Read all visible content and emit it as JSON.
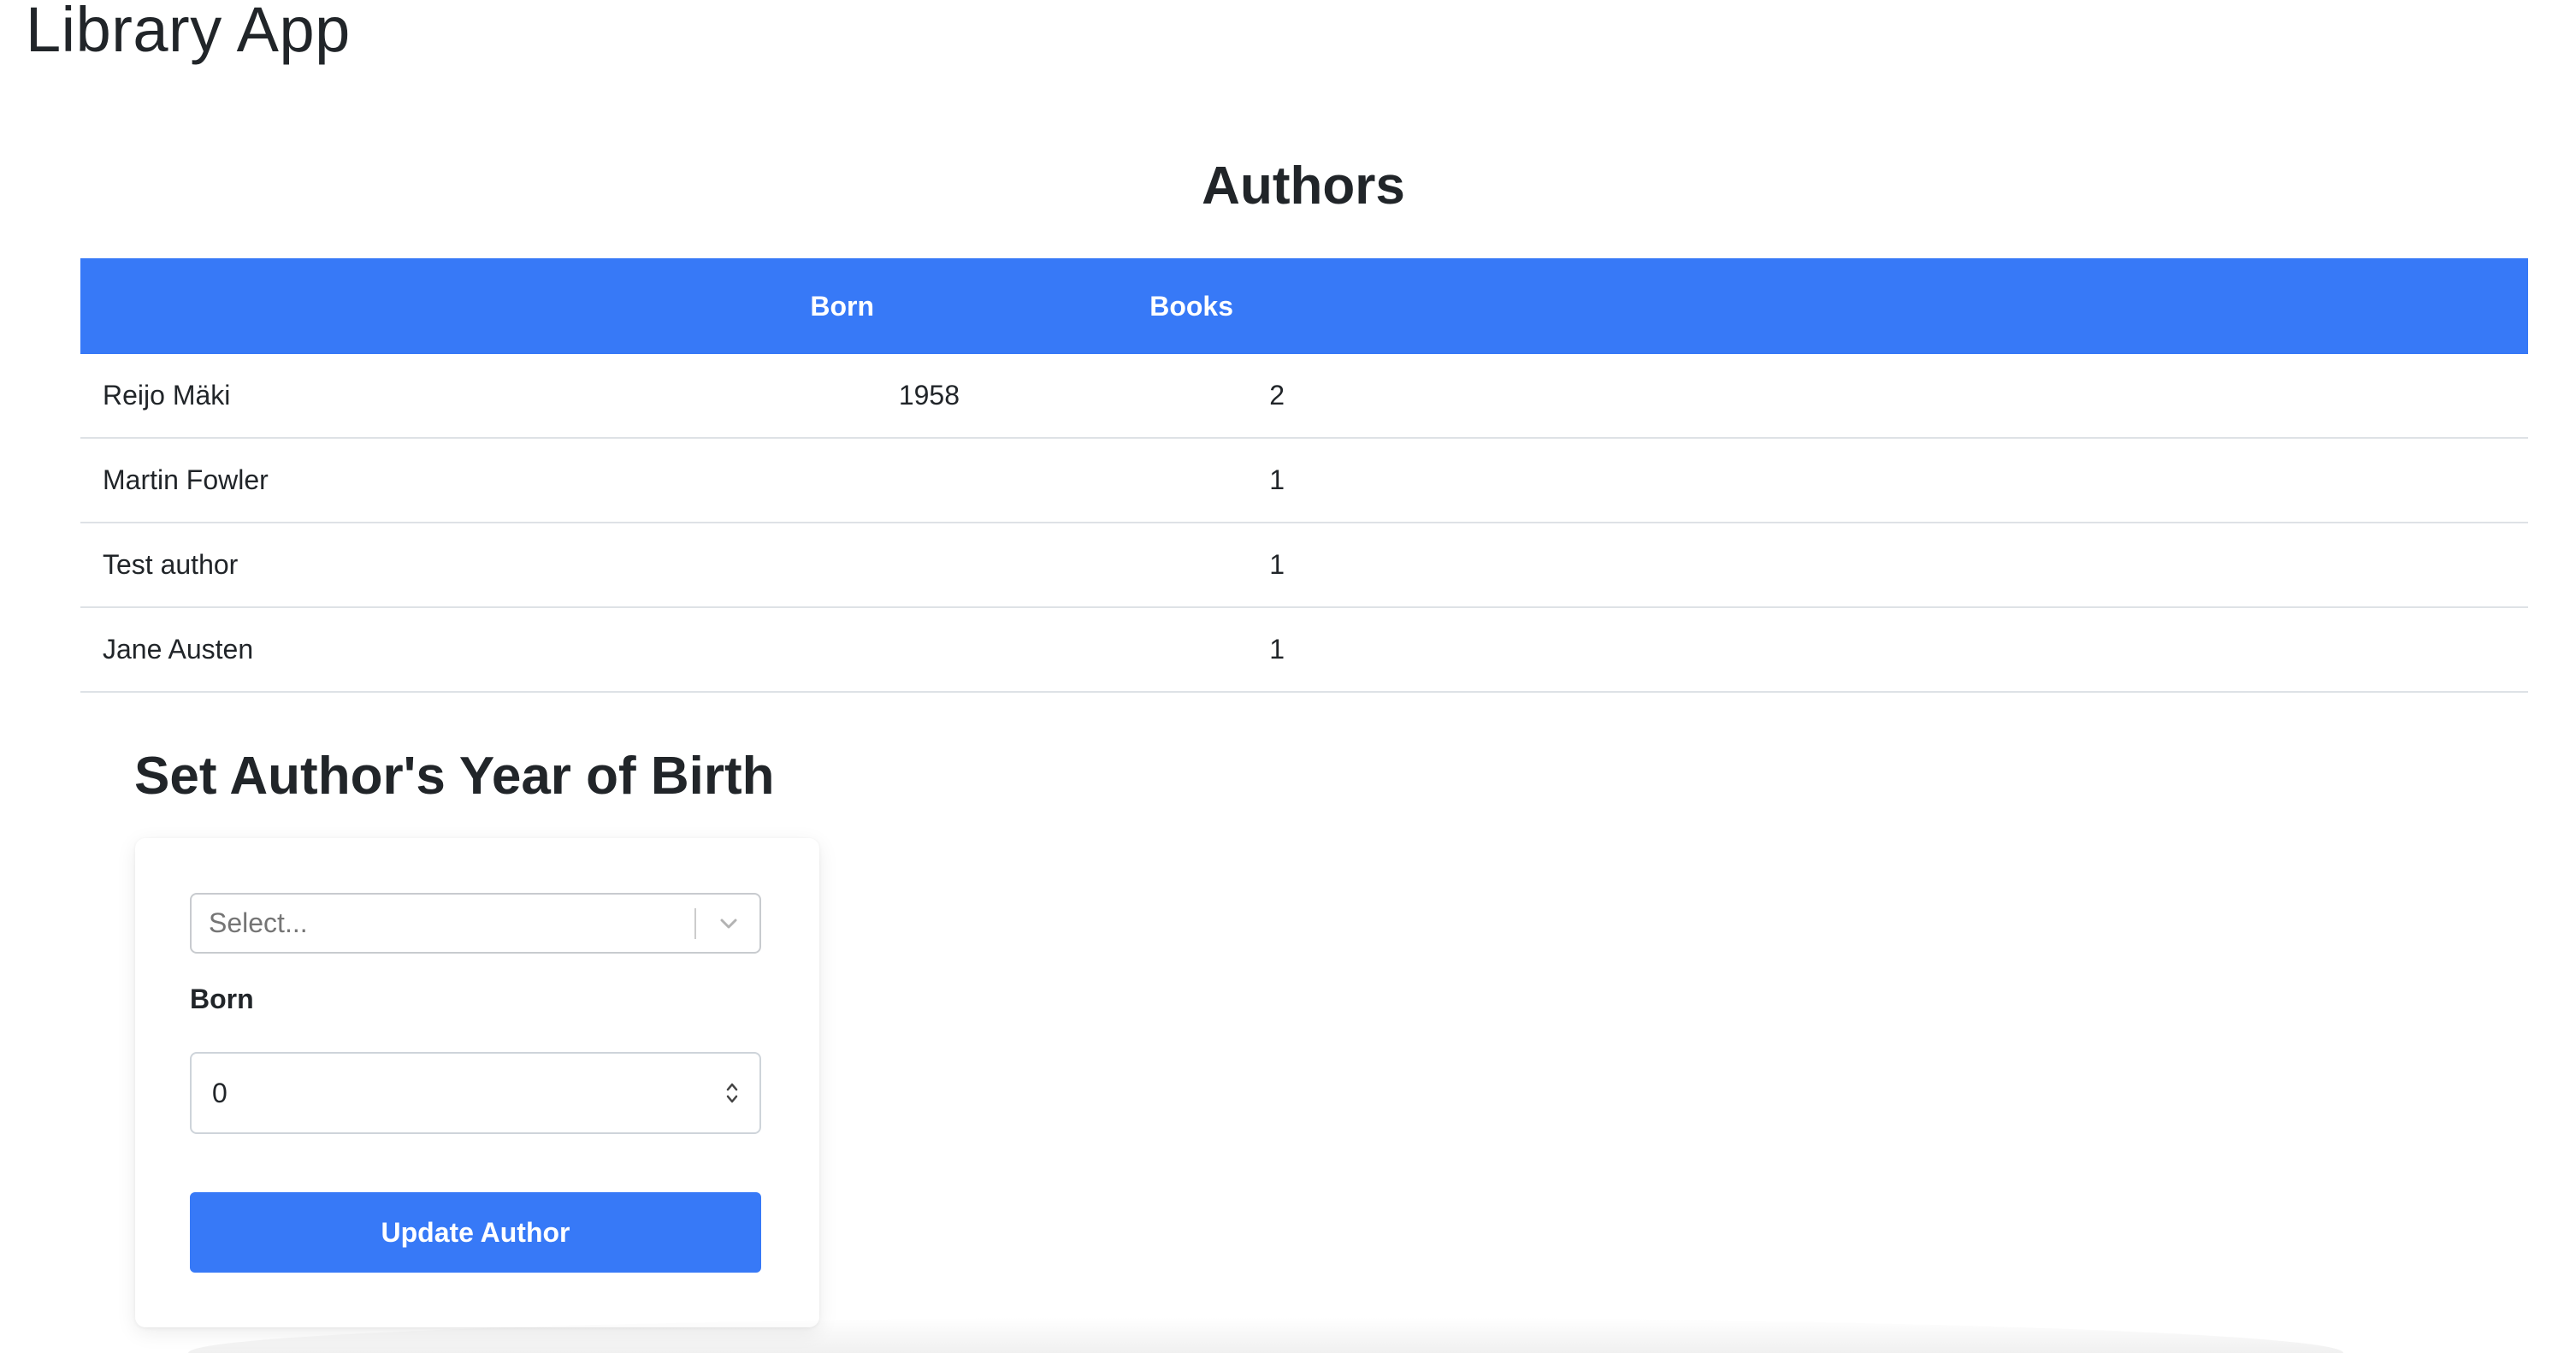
{
  "app": {
    "title": "Library App"
  },
  "authors_section": {
    "title": "Authors",
    "columns": [
      "",
      "Born",
      "Books"
    ],
    "rows": [
      {
        "name": "Reijo Mäki",
        "born": "1958",
        "books": "2"
      },
      {
        "name": "Martin Fowler",
        "born": "",
        "books": "1"
      },
      {
        "name": "Test author",
        "born": "",
        "books": "1"
      },
      {
        "name": "Jane Austen",
        "born": "",
        "books": "1"
      }
    ]
  },
  "birth_form": {
    "title": "Set Author's Year of Birth",
    "select_placeholder": "Select...",
    "born_label": "Born",
    "born_value": "0",
    "submit_label": "Update Author"
  },
  "colors": {
    "accent": "#3779f7",
    "text": "#212529",
    "row_border": "#dee2e6"
  },
  "icons": [
    "chevron-down-icon",
    "number-spinner-icon"
  ]
}
